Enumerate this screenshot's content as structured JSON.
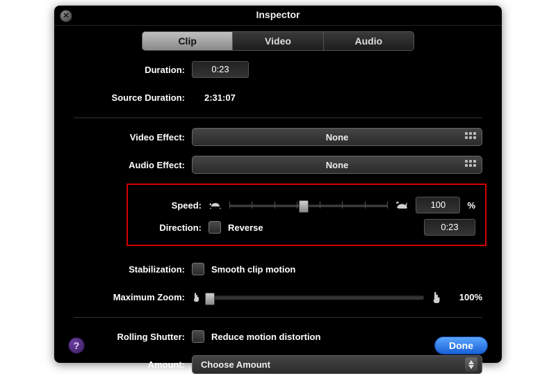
{
  "window": {
    "title": "Inspector"
  },
  "tabs": [
    "Clip",
    "Video",
    "Audio"
  ],
  "labels": {
    "duration": "Duration:",
    "source_duration": "Source Duration:",
    "video_effect": "Video Effect:",
    "audio_effect": "Audio Effect:",
    "speed": "Speed:",
    "direction": "Direction:",
    "reverse": "Reverse",
    "stabilization": "Stabilization:",
    "smooth_clip": "Smooth clip motion",
    "maximum_zoom": "Maximum Zoom:",
    "rolling_shutter": "Rolling Shutter:",
    "reduce_distortion": "Reduce motion distortion",
    "amount": "Amount:"
  },
  "values": {
    "duration": "0:23",
    "source_duration": "2:31:07",
    "video_effect": "None",
    "audio_effect": "None",
    "speed_percent": "100",
    "direction_duration": "0:23",
    "maximum_zoom": "100%",
    "amount": "Choose Amount"
  },
  "checkboxes": {
    "reverse": false,
    "smooth_clip_motion": false,
    "reduce_motion_distortion": false
  },
  "buttons": {
    "done": "Done"
  },
  "icons": {
    "close": "close-icon",
    "grid": "grid-icon",
    "turtle": "turtle-icon",
    "rabbit": "rabbit-icon",
    "hand_small": "hand-small-icon",
    "hand_large": "hand-large-icon",
    "help": "help-icon",
    "stepper": "stepper-arrows-icon"
  },
  "colors": {
    "panel_bg": "#000000",
    "highlight_border": "#d40000",
    "done_button": "#2f78e6",
    "tab_active": "#a8a8a8"
  }
}
